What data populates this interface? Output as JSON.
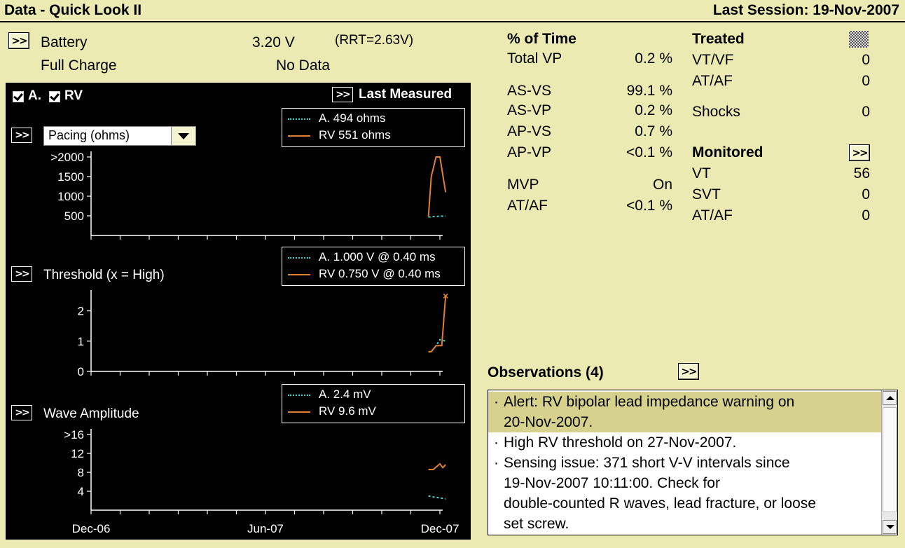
{
  "header": {
    "title": "Data - Quick Look II",
    "session": "Last Session: 19-Nov-2007"
  },
  "battery": {
    "label": "Battery",
    "value": "3.20 V",
    "rrt": "(RRT=2.63V)",
    "charge_label": "Full Charge",
    "charge_value": "No Data"
  },
  "panel": {
    "chk_a": "A.",
    "chk_rv": "RV",
    "last_measured": "Last Measured",
    "pacing": {
      "select_value": "Pacing (ohms)",
      "legend_a": "A.  494 ohms",
      "legend_rv": "RV  551 ohms",
      "ticks": [
        ">2000",
        "1500",
        "1000",
        "500"
      ]
    },
    "threshold": {
      "label": "Threshold (x = High)",
      "legend_a": "A.  1.000 V @ 0.40 ms",
      "legend_rv": "RV  0.750 V @ 0.40 ms",
      "ticks": [
        "2",
        "1",
        "0"
      ]
    },
    "wave": {
      "label": "Wave Amplitude",
      "legend_a": "A.  2.4 mV",
      "legend_rv": "RV  9.6 mV",
      "ticks": [
        ">16",
        "12",
        "8",
        "4"
      ]
    },
    "x_labels": [
      "Dec-06",
      "Jun-07",
      "Dec-07"
    ]
  },
  "chart_data": [
    {
      "type": "line",
      "title": "Pacing (ohms)",
      "x_range": [
        "Dec-06",
        "Dec-07"
      ],
      "ylim": [
        0,
        2000
      ],
      "series": [
        {
          "name": "A.",
          "x": [
            "2007-11-19",
            "2007-11-24",
            "2007-12-01",
            "2007-12-07"
          ],
          "values": [
            470,
            480,
            490,
            494
          ]
        },
        {
          "name": "RV",
          "x": [
            "2007-11-19",
            "2007-11-22",
            "2007-11-27",
            "2007-12-01",
            "2007-12-07"
          ],
          "values": [
            480,
            1500,
            2000,
            2000,
            1100
          ]
        }
      ]
    },
    {
      "type": "line",
      "title": "Threshold (x = High)",
      "x_range": [
        "Dec-06",
        "Dec-07"
      ],
      "ylim": [
        0,
        2.5
      ],
      "series": [
        {
          "name": "A.",
          "x": [
            "2007-11-19",
            "2007-11-22",
            "2007-11-27",
            "2007-12-01",
            "2007-12-07"
          ],
          "values": [
            0.65,
            0.65,
            0.85,
            1.05,
            1.0
          ]
        },
        {
          "name": "RV",
          "x": [
            "2007-11-19",
            "2007-11-22",
            "2007-11-27",
            "2007-12-03",
            "2007-12-07"
          ],
          "values": [
            0.65,
            0.65,
            0.85,
            0.85,
            2.5
          ]
        }
      ]
    },
    {
      "type": "line",
      "title": "Wave Amplitude",
      "x_range": [
        "Dec-06",
        "Dec-07"
      ],
      "ylim": [
        0,
        16
      ],
      "series": [
        {
          "name": "A.",
          "x": [
            "2007-11-19",
            "2007-11-24",
            "2007-12-01",
            "2007-12-07"
          ],
          "values": [
            3.0,
            2.8,
            2.6,
            2.4
          ]
        },
        {
          "name": "RV",
          "x": [
            "2007-11-19",
            "2007-11-24",
            "2007-12-01",
            "2007-12-04",
            "2007-12-07"
          ],
          "values": [
            8.6,
            8.6,
            9.8,
            9.0,
            9.6
          ]
        }
      ]
    }
  ],
  "time": {
    "heading": "% of Time",
    "rows": [
      {
        "label": "Total VP",
        "value": "0.2 %"
      },
      {
        "label": "AS-VS",
        "value": "99.1 %"
      },
      {
        "label": "AS-VP",
        "value": "0.2 %"
      },
      {
        "label": "AP-VS",
        "value": "0.7 %"
      },
      {
        "label": "AP-VP",
        "value": "<0.1 %"
      },
      {
        "label": "MVP",
        "value": "On"
      },
      {
        "label": "AT/AF",
        "value": "<0.1 %"
      }
    ]
  },
  "treated": {
    "heading": "Treated",
    "rows": [
      {
        "label": "VT/VF",
        "value": "0"
      },
      {
        "label": "AT/AF",
        "value": "0"
      },
      {
        "label": "Shocks",
        "value": "0"
      }
    ]
  },
  "monitored": {
    "heading": "Monitored",
    "rows": [
      {
        "label": "VT",
        "value": "56"
      },
      {
        "label": "SVT",
        "value": "0"
      },
      {
        "label": "AT/AF",
        "value": "0"
      }
    ]
  },
  "observations": {
    "heading": "Observations (4)",
    "items": [
      {
        "line1": "Alert: RV bipolar lead impedance warning on",
        "line2": "20-Nov-2007."
      },
      {
        "line1": "High RV threshold on 27-Nov-2007."
      },
      {
        "line1": "Sensing issue: 371 short V-V intervals since",
        "line2": "19-Nov-2007 10:11:00. Check for",
        "line3": "double-counted R waves, lead fracture, or loose",
        "line4": "set screw."
      }
    ]
  },
  "button_label": ">>",
  "colors": {
    "background": "#eaeab2",
    "atrial": "#38d6d6",
    "ventricular": "#e08030",
    "highlight": "#d6d28e"
  }
}
